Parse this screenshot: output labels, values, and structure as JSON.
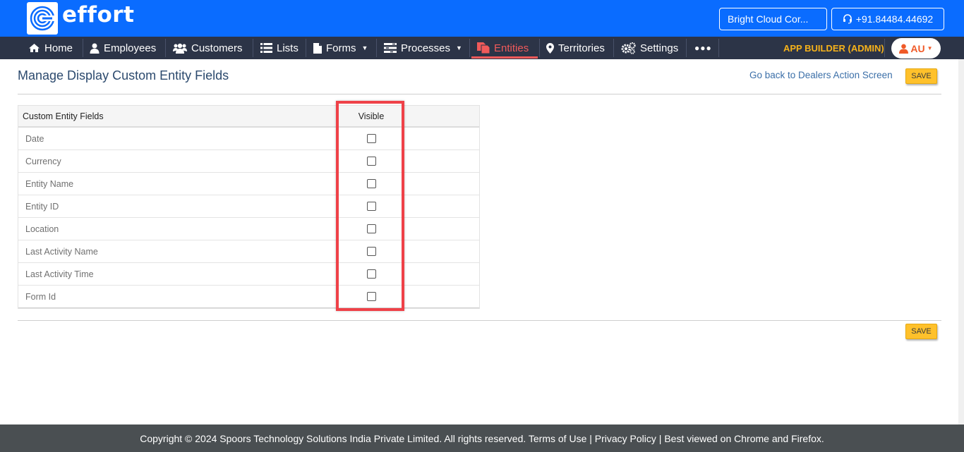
{
  "brand": {
    "name": "effort"
  },
  "header": {
    "company": "Bright Cloud Cor...",
    "phone": "+91.84484.44692"
  },
  "nav": {
    "items": [
      {
        "label": "Home",
        "icon": "home-icon"
      },
      {
        "label": "Employees",
        "icon": "user-icon"
      },
      {
        "label": "Customers",
        "icon": "users-icon"
      },
      {
        "label": "Lists",
        "icon": "list-icon"
      },
      {
        "label": "Forms",
        "icon": "file-icon"
      },
      {
        "label": "Processes",
        "icon": "processes-icon"
      },
      {
        "label": "Entities",
        "icon": "entities-icon"
      },
      {
        "label": "Territories",
        "icon": "map-pin-icon"
      },
      {
        "label": "Settings",
        "icon": "gears-icon"
      },
      {
        "label": "●●●",
        "icon": "more-icon"
      }
    ],
    "active": "Entities",
    "role": "APP BUILDER (ADMIN)",
    "user_initials": "AU"
  },
  "page": {
    "title": "Manage Display Custom Entity Fields",
    "back_link": "Go back to Dealers Action Screen",
    "save_label": "SAVE"
  },
  "table": {
    "headers": {
      "name": "Custom Entity Fields",
      "visible": "Visible"
    },
    "rows": [
      {
        "name": "Date",
        "visible": false
      },
      {
        "name": "Currency",
        "visible": false
      },
      {
        "name": "Entity Name",
        "visible": false
      },
      {
        "name": "Entity ID",
        "visible": false
      },
      {
        "name": "Location",
        "visible": false
      },
      {
        "name": "Last Activity Name",
        "visible": false
      },
      {
        "name": "Last Activity Time",
        "visible": false
      },
      {
        "name": "Form Id",
        "visible": false
      }
    ]
  },
  "footer": {
    "text": "Copyright © 2024 Spoors Technology Solutions India Private Limited. All rights reserved. Terms of Use | Privacy Policy | Best viewed on Chrome and Firefox."
  },
  "colors": {
    "topbar": "#0a6cff",
    "navbar": "#2c3447",
    "active": "#f05a5a",
    "save": "#ffc12b",
    "highlight": "#ef4148",
    "footer": "#4a4f52"
  }
}
